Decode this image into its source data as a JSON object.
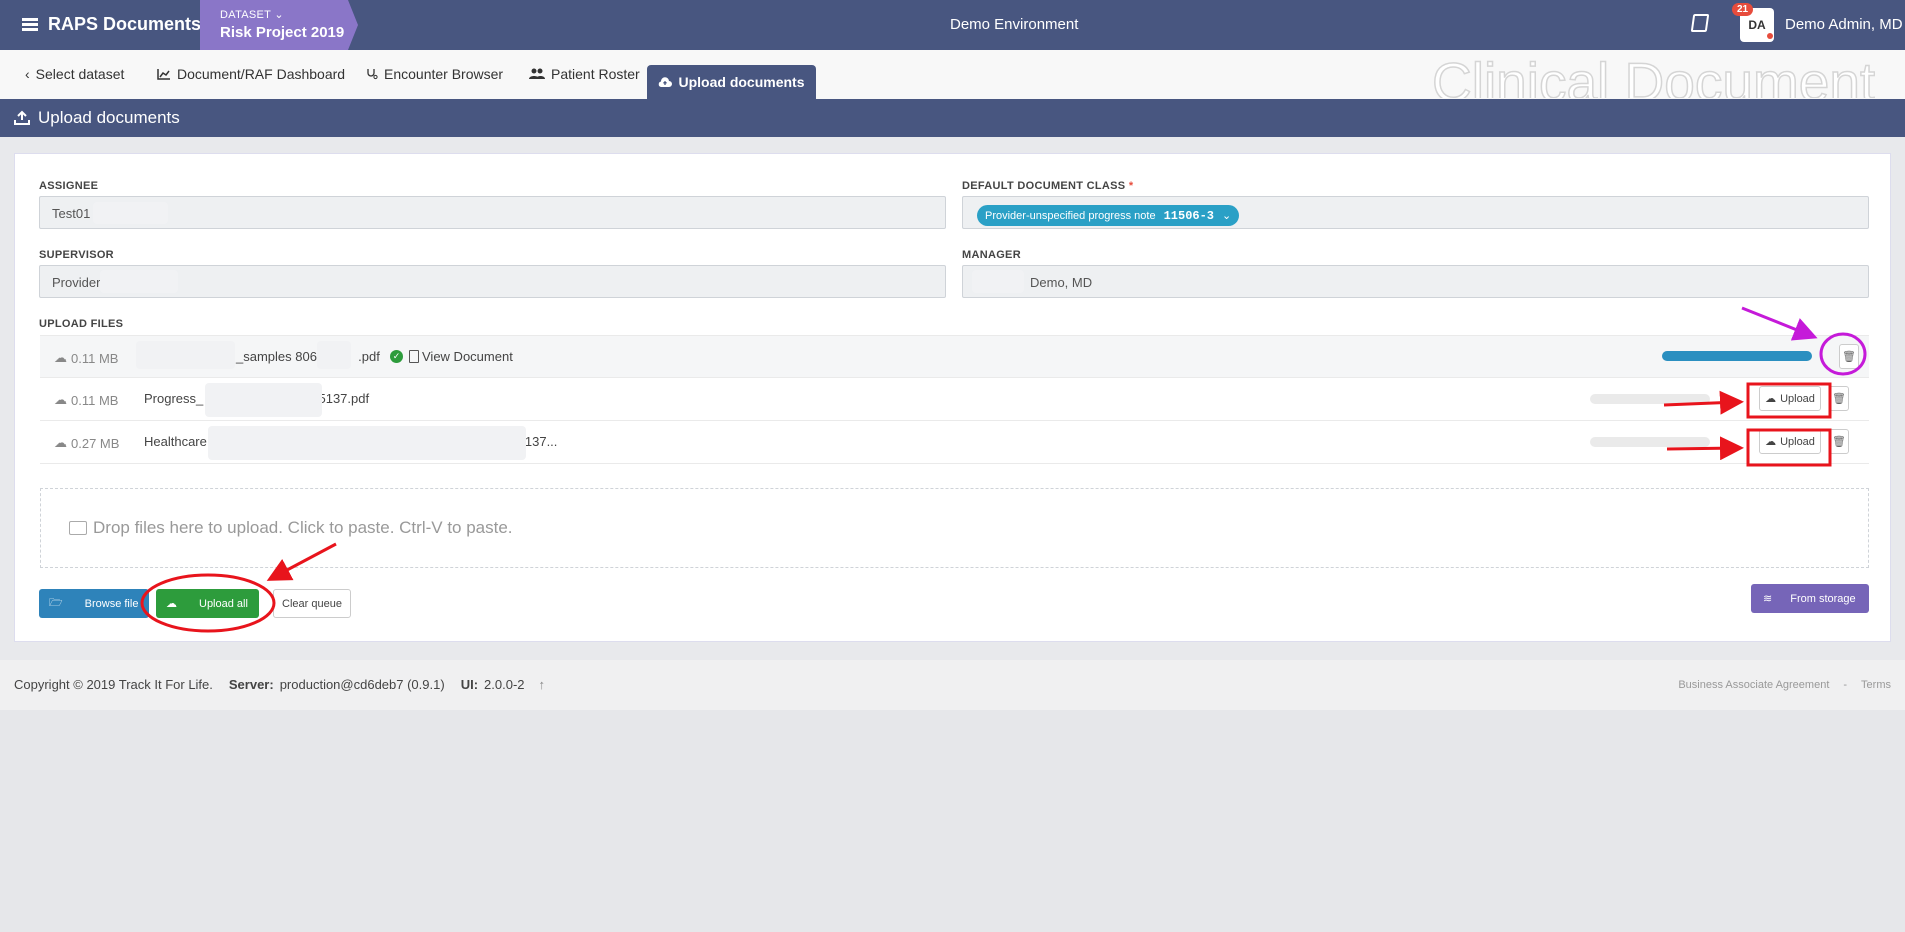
{
  "app": {
    "title": "RAPS Documents",
    "environment": "Demo Environment"
  },
  "dataset": {
    "label": "DATASET",
    "name": "Risk Project 2019"
  },
  "user": {
    "initials": "DA",
    "notifications": "21",
    "name": "Demo Admin, MD"
  },
  "tabs": [
    {
      "label": "Select dataset"
    },
    {
      "label": "Document/RAF Dashboard"
    },
    {
      "label": "Encounter Browser"
    },
    {
      "label": "Patient Roster"
    },
    {
      "label": "Upload documents"
    }
  ],
  "watermark": "Clinical Document",
  "page": {
    "title": "Upload documents"
  },
  "form": {
    "assignee": {
      "label": "ASSIGNEE",
      "value": "Test01"
    },
    "default_class": {
      "label": "DEFAULT DOCUMENT CLASS",
      "required": "*",
      "tag_label": "Provider-unspecified progress note",
      "tag_code": "11506-3"
    },
    "supervisor": {
      "label": "SUPERVISOR",
      "value": "Provider"
    },
    "manager": {
      "label": "MANAGER",
      "value": "Demo, MD"
    },
    "upload_label": "UPLOAD FILES"
  },
  "files": [
    {
      "size": "0.11 MB",
      "name_part1": "_samples 8063",
      "name_part2": ".pdf",
      "view_label": "View Document",
      "progress": 1.0
    },
    {
      "size": "0.11 MB",
      "name_part1": "Progress_",
      "name_part2": "35137.pdf",
      "upload_label": "Upload",
      "progress": 0
    },
    {
      "size": "0.27 MB",
      "name_part1": "Healthcare",
      "name_part2": "137...",
      "upload_label": "Upload",
      "progress": 0
    }
  ],
  "dropzone": {
    "text": "Drop files here to upload. Click to paste. Ctrl-V to paste."
  },
  "actions": {
    "browse": "Browse file",
    "upload_all": "Upload all",
    "clear": "Clear queue",
    "storage": "From storage"
  },
  "footer": {
    "copyright": "Copyright © 2019 Track It For Life.",
    "server_label": "Server:",
    "server_value": "production@cd6deb7 (0.9.1)",
    "ui_label": "UI:",
    "ui_value": "2.0.0-2",
    "baa": "Business Associate Agreement",
    "sep": "-",
    "terms": "Terms"
  },
  "colors": {
    "header": "#485680",
    "dataset": "#8a76c8",
    "accent": "#2aa0c6",
    "success": "#2d9c3c",
    "storage": "#7665b8",
    "annotation_red": "#e8141c",
    "annotation_magenta": "#c51ad9"
  }
}
